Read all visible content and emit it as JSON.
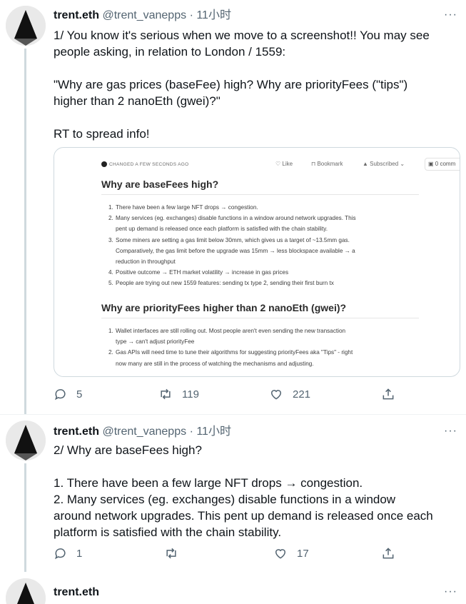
{
  "tweets": [
    {
      "name": "trent.eth",
      "handle": "@trent_vanepps",
      "sep": "·",
      "time": "11小时",
      "more": "···",
      "text_lines": [
        "1/ You know it's serious when we move to a screenshot!! You may see",
        "people asking, in relation to London / 1559:",
        "\"Why are gas prices (baseFee) high? Why are priorityFees (\"tips\")",
        "higher than 2 nanoEth (gwei)?\"",
        "RT to spread info!"
      ],
      "replies": "5",
      "retweets": "119",
      "likes": "221"
    },
    {
      "name": "trent.eth",
      "handle": "@trent_vanepps",
      "sep": "·",
      "time": "11小时",
      "more": "···",
      "text_lines": [
        "2/ Why are baseFees high?",
        "1. There have been a few large NFT drops → congestion.",
        "2. Many services (eg. exchanges) disable functions in a window",
        "around network upgrades. This pent up demand is released once each",
        "platform is satisfied with the chain stability."
      ],
      "replies": "1",
      "retweets": "",
      "likes": "17"
    },
    {
      "name": "trent.eth",
      "more": "···"
    }
  ],
  "card": {
    "meta": "CHANGED A FEW SECONDS AGO",
    "toolbar": {
      "like": "Like",
      "bookmark": "Bookmark",
      "subscribed": "Subscribed",
      "comments": "0 comm"
    },
    "heading1": "Why are baseFees high?",
    "list1": [
      {
        "n": "1.",
        "lines": [
          "There have been a few large NFT drops → congestion."
        ]
      },
      {
        "n": "2.",
        "lines": [
          "Many services (eg. exchanges) disable functions in a window around network upgrades. This",
          "pent up demand is released once each platform is satisfied with the chain stability."
        ]
      },
      {
        "n": "3.",
        "lines": [
          "Some miners are setting a gas limit below 30mm, which gives us a target of ~13.5mm gas.",
          "Comparatively, the gas limit before the upgrade was 15mm → less blockspace available → a",
          "reduction in throughput"
        ]
      },
      {
        "n": "4.",
        "lines": [
          "Positive outcome → ETH market volatility → increase in gas prices"
        ]
      },
      {
        "n": "5.",
        "lines": [
          "People are trying out new 1559 features: sending tx type 2, sending their first burn tx"
        ]
      }
    ],
    "heading2": "Why are priorityFees higher than 2 nanoEth (gwei)?",
    "list2": [
      {
        "n": "1.",
        "lines": [
          "Wallet interfaces are still rolling out. Most people aren't even sending the new transaction",
          "type → can't adjust priorityFee"
        ]
      },
      {
        "n": "2.",
        "lines": [
          "Gas APIs will need time to tune their algorithms for suggesting priorityFees aka \"Tips\" - right",
          "now many are still in the process of watching the mechanisms and adjusting."
        ]
      }
    ]
  },
  "icons": {
    "reply": "reply-icon",
    "retweet": "retweet-icon",
    "like": "heart-icon",
    "share": "share-icon",
    "avatar": "triangle-logo-avatar"
  },
  "colors": {
    "text": "#0f1419",
    "muted": "#536471",
    "thread": "#cfd9de"
  }
}
